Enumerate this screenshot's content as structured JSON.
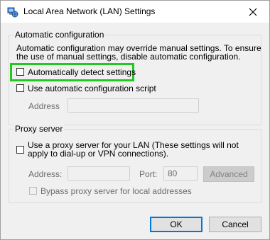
{
  "window": {
    "title": "Local Area Network (LAN) Settings",
    "icons": {
      "app": "network-settings-icon",
      "close": "close-icon"
    }
  },
  "auto_config": {
    "group_label": "Automatic configuration",
    "description": "Automatic configuration may override manual settings.  To ensure the use of manual settings, disable automatic configuration.",
    "auto_detect": {
      "label": "Automatically detect settings",
      "checked": false,
      "highlighted": true,
      "highlight_color": "#22c722"
    },
    "use_script": {
      "label": "Use automatic configuration script",
      "checked": false
    },
    "address_label": "Address",
    "address_value": ""
  },
  "proxy": {
    "group_label": "Proxy server",
    "use_proxy": {
      "label": "Use a proxy server for your LAN (These settings will not apply to dial-up or VPN connections).",
      "checked": false
    },
    "address_label": "Address:",
    "address_value": "",
    "port_label": "Port:",
    "port_value": "80",
    "advanced_label": "Advanced",
    "bypass": {
      "label": "Bypass proxy server for local addresses",
      "checked": false
    }
  },
  "buttons": {
    "ok": "OK",
    "cancel": "Cancel"
  }
}
